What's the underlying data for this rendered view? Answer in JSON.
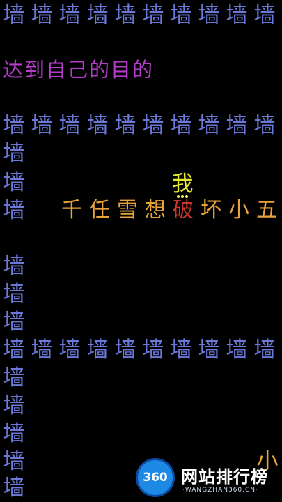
{
  "wall_char": "墙",
  "goal_text": "达到自己的目的",
  "player_char": "我",
  "sentence": [
    {
      "char": "千",
      "role": "normal"
    },
    {
      "char": "任",
      "role": "normal"
    },
    {
      "char": "雪",
      "role": "normal"
    },
    {
      "char": "想",
      "role": "normal"
    },
    {
      "char": "破",
      "role": "break"
    },
    {
      "char": "坏",
      "role": "normal"
    },
    {
      "char": "小",
      "role": "normal"
    },
    {
      "char": "五",
      "role": "normal"
    }
  ],
  "small_char": "小",
  "watermark": {
    "logo_text": "360",
    "title": "网站排行榜",
    "subtitle": "·WANGZHAN360.CN·"
  },
  "colors": {
    "wall": "#6a78d8",
    "goal": "#b33cc8",
    "player": "#e8e832",
    "sentence": "#e8a43a",
    "break": "#c8382e",
    "background": "#000000"
  }
}
